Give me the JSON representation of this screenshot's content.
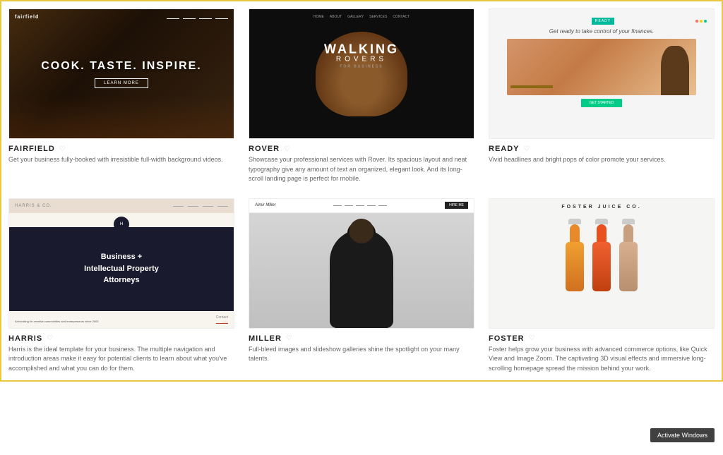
{
  "cards": [
    {
      "id": "fairfield",
      "title": "FAIRFIELD",
      "heart": "♡",
      "description": "Get your business fully-booked with irresistible full-width background videos.",
      "hero_text": "COOK. TASTE. INSPIRE.",
      "cta_text": "LEARN MORE"
    },
    {
      "id": "rover",
      "title": "ROVER",
      "heart": "♡",
      "description": "Showcase your professional services with Rover. Its spacious layout and neat typography give any amount of text an organized, elegant look. And its long-scroll landing page is perfect for mobile.",
      "hero_line1": "WALKING",
      "hero_line2": "ROVERS",
      "hero_sub": "FOR BUSINESS"
    },
    {
      "id": "ready",
      "title": "READY",
      "heart": "♡",
      "description": "Vivid headlines and bright pops of color promote your services.",
      "tagline": "Get ready to take control of your finances."
    },
    {
      "id": "harris",
      "title": "HARRIS",
      "heart": "♡",
      "description": "Harris is the ideal template for your business. The multiple navigation and introduction areas make it easy for potential clients to learn about what you've accomplished and what you can do for them.",
      "hero_line1": "Business +",
      "hero_line2": "Intellectual Property",
      "hero_line3": "Attorneys",
      "footer_text": "Advocating for creative communities and entrepreneurs since 2003",
      "contact_label": "Contact",
      "initials": "H"
    },
    {
      "id": "miller",
      "title": "MILLER",
      "heart": "♡",
      "description": "Full-bleed images and slideshow galleries shine the spotlight on your many talents.",
      "name": "Almir Miller"
    },
    {
      "id": "foster",
      "title": "FOSTER",
      "heart": "♡",
      "description": "Foster helps grow your business with advanced commerce options, like Quick View and Image Zoom. The captivating 3D visual effects and immersive long-scrolling homepage spread the mission behind your work.",
      "brand": "FOSTER JUICE CO."
    }
  ],
  "activate_text": "Activate Windows"
}
